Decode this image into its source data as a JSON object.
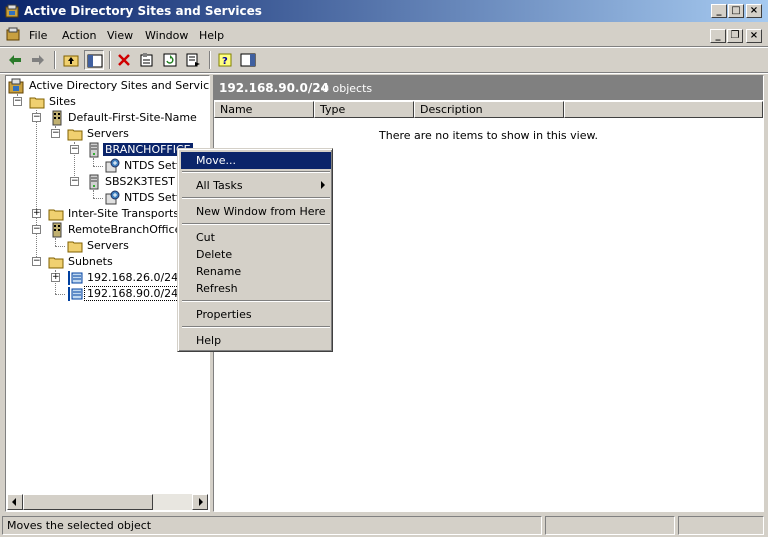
{
  "window": {
    "title": "Active Directory Sites and Services"
  },
  "menu": {
    "file": "File",
    "action": "Action",
    "view": "View",
    "window": "Window",
    "help": "Help"
  },
  "toolbar": {
    "icons": [
      "back-arrow-icon",
      "forward-arrow-icon",
      "up-level-icon",
      "show-hide-tree-icon",
      "delete-icon",
      "properties-icon",
      "refresh-icon",
      "export-list-icon",
      "help-icon",
      "show-hide-action-pane-icon"
    ]
  },
  "tree": {
    "root": "Active Directory Sites and Services [E",
    "sites": "Sites",
    "default_site": "Default-First-Site-Name",
    "servers1": "Servers",
    "branchoffice": "BRANCHOFFICE",
    "ntds1": "NTDS Setti",
    "sbs2k3test": "SBS2K3TEST",
    "ntds2": "NTDS Setti",
    "inter_site": "Inter-Site Transports",
    "remote_branch": "RemoteBranchOffice",
    "servers2": "Servers",
    "subnets": "Subnets",
    "subnet1": "192.168.26.0/24",
    "subnet2": "192.168.90.0/24"
  },
  "right_pane": {
    "path": "192.168.90.0/24",
    "count": "0 objects",
    "columns": [
      "Name",
      "Type",
      "Description"
    ],
    "empty_message": "There are no items to show in this view."
  },
  "context_menu": {
    "move": "Move...",
    "all_tasks": "All Tasks",
    "new_window": "New Window from Here",
    "cut": "Cut",
    "delete": "Delete",
    "rename": "Rename",
    "refresh": "Refresh",
    "properties": "Properties",
    "help": "Help"
  },
  "status": {
    "text": "Moves the selected object"
  },
  "colors": {
    "title_start": "#0a246a",
    "title_end": "#a6caf0",
    "highlight": "#0a246a",
    "face": "#d4d0c8"
  }
}
